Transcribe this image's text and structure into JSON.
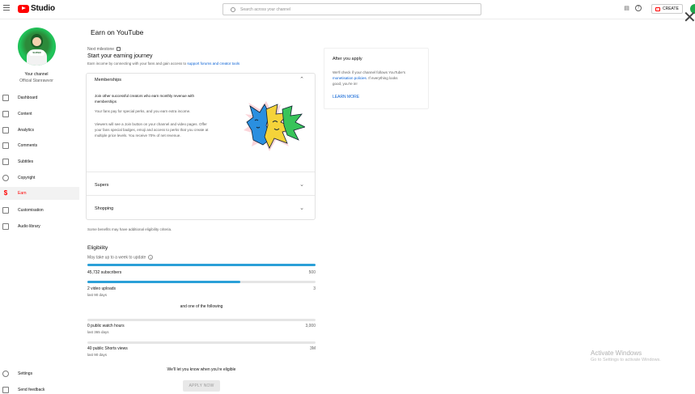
{
  "topbar": {
    "brand": "Studio",
    "search_placeholder": "Search across your channel",
    "create_label": "CREATE"
  },
  "sidebar": {
    "channel_name": "Your channel",
    "channel_handle": "Official Stanrawvor",
    "items": [
      {
        "label": "Dashboard",
        "icon": "dashboard-icon"
      },
      {
        "label": "Content",
        "icon": "content-icon"
      },
      {
        "label": "Analytics",
        "icon": "analytics-icon"
      },
      {
        "label": "Comments",
        "icon": "comments-icon"
      },
      {
        "label": "Subtitles",
        "icon": "subtitles-icon"
      },
      {
        "label": "Copyright",
        "icon": "copyright-icon"
      },
      {
        "label": "Earn",
        "icon": "earn-icon",
        "active": true
      },
      {
        "label": "Customisation",
        "icon": "customisation-icon"
      },
      {
        "label": "Audio library",
        "icon": "audio-library-icon"
      }
    ],
    "bottom": [
      {
        "label": "Settings",
        "icon": "settings-icon"
      },
      {
        "label": "Send feedback",
        "icon": "feedback-icon"
      }
    ]
  },
  "main": {
    "title": "Earn on YouTube",
    "next_milestone": "Next milestone",
    "journey_title": "Start your earning journey",
    "journey_desc_prefix": "Earn income by connecting with your fans and gain access to ",
    "journey_desc_link": "support forums and creator tools",
    "memberships": {
      "title": "Memberships",
      "p1": "Join other successful creators who earn monthly revenue with",
      "p1b": "memberships",
      "p2": "Your fans pay for special perks, and you earn extra income.",
      "p3a": "Viewers will see a Join button on your channel and video pages. Offer",
      "p3b": "your fans special badges, emoji and access to perks that you create at",
      "p3c": "multiple price levels. You receive 70% of net revenue."
    },
    "supers_title": "Supers",
    "shopping_title": "Shopping",
    "eligibility_note": "Some benefits may have additional eligibility criteria.",
    "eligibility_title": "Eligibility",
    "eligibility_sub": "May take up to a week to update",
    "subscribers_label": "45,732 subscribers",
    "subscribers_target": "500",
    "uploads_label": "2 video uploads",
    "uploads_sub": "last 90 days",
    "uploads_target": "3",
    "one_of_following": "and one of the following",
    "watch_hours_label": "0 public watch hours",
    "watch_hours_sub": "last 365 days",
    "watch_hours_target": "3,000",
    "shorts_label": "40 public Shorts views",
    "shorts_sub": "last 90 days",
    "shorts_target": "3M",
    "eligible_note": "We'll let you know when you're eligible",
    "apply_label": "APPLY NOW"
  },
  "after_apply": {
    "title": "After you apply",
    "d1": "We'll check if your channel follows YouTube's",
    "d2_link": "monetisation policies",
    "d2_rest": ". If everything looks",
    "d3": "good, you're in!",
    "more": "LEARN MORE"
  },
  "watermark": {
    "title": "Activate Windows",
    "sub": "Go to Settings to activate Windows."
  },
  "progress": {
    "subscribers": 1.0,
    "uploads": 0.67,
    "watch_hours": 0,
    "shorts": 0
  },
  "colors": {
    "accent": "#ff0000",
    "progress": "#2ba0d8",
    "link": "#065fd4"
  }
}
